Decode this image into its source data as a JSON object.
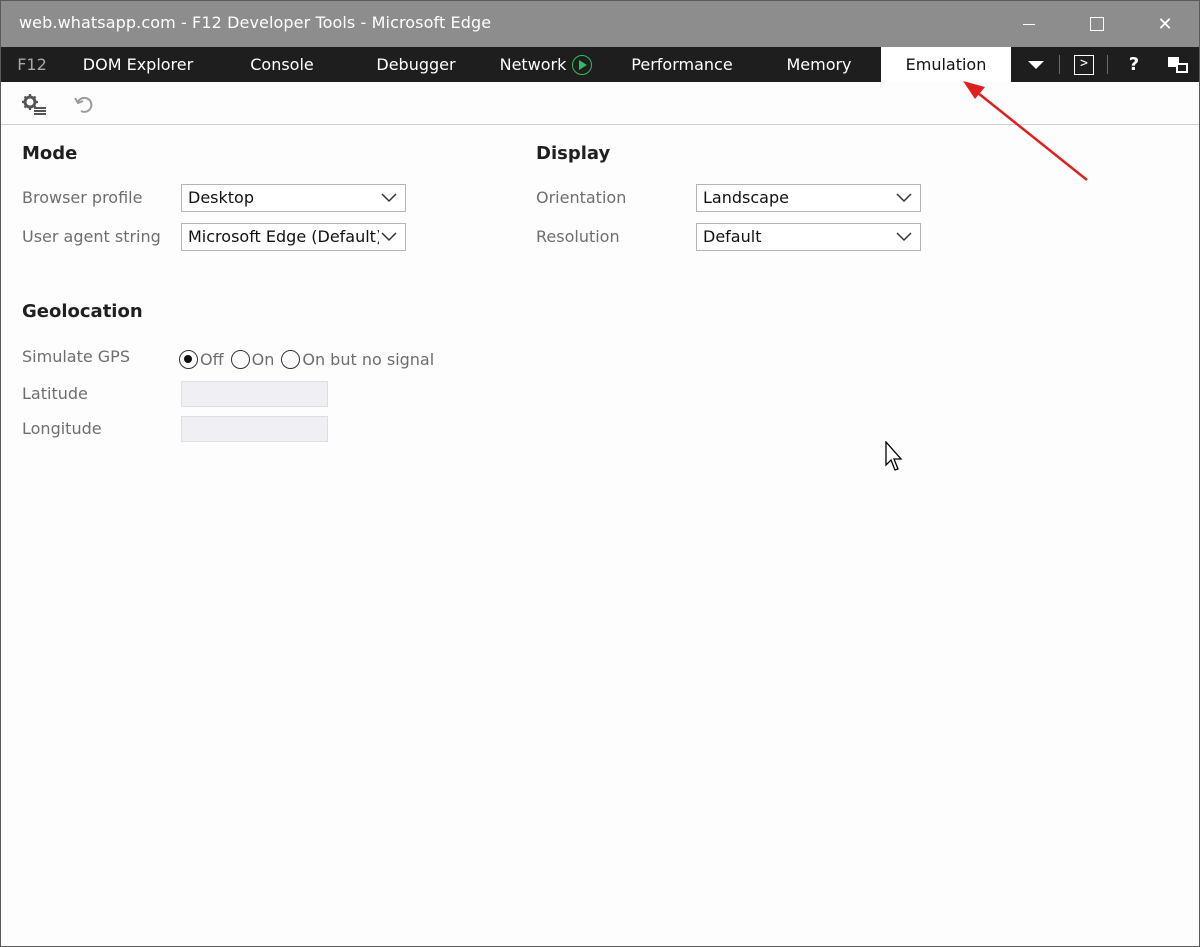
{
  "window": {
    "title": "web.whatsapp.com - F12 Developer Tools - Microsoft Edge",
    "controls": {
      "minimize": "minimize",
      "maximize": "maximize",
      "close": "✕"
    }
  },
  "tabs": {
    "f12": "F12",
    "items": [
      "DOM Explorer",
      "Console",
      "Debugger",
      "Network",
      "Performance",
      "Memory",
      "Emulation"
    ],
    "active": "Emulation"
  },
  "tab_tools": {
    "help": "?",
    "console_glyph": ">"
  },
  "toolbar": {
    "undo_glyph": "↶"
  },
  "mode": {
    "title": "Mode",
    "browser_profile_label": "Browser profile",
    "browser_profile_value": "Desktop",
    "user_agent_label": "User agent string",
    "user_agent_value": "Microsoft Edge (Default)"
  },
  "display": {
    "title": "Display",
    "orientation_label": "Orientation",
    "orientation_value": "Landscape",
    "resolution_label": "Resolution",
    "resolution_value": "Default"
  },
  "geolocation": {
    "title": "Geolocation",
    "simulate_gps_label": "Simulate GPS",
    "options": [
      "Off",
      "On",
      "On but no signal"
    ],
    "selected": "Off",
    "latitude_label": "Latitude",
    "latitude_value": "",
    "longitude_label": "Longitude",
    "longitude_value": ""
  },
  "colors": {
    "titlebar": "#8d8d8d",
    "tabbar": "#1e1e1e",
    "network_play": "#2fbf5a",
    "annotation_arrow": "#e02020"
  }
}
